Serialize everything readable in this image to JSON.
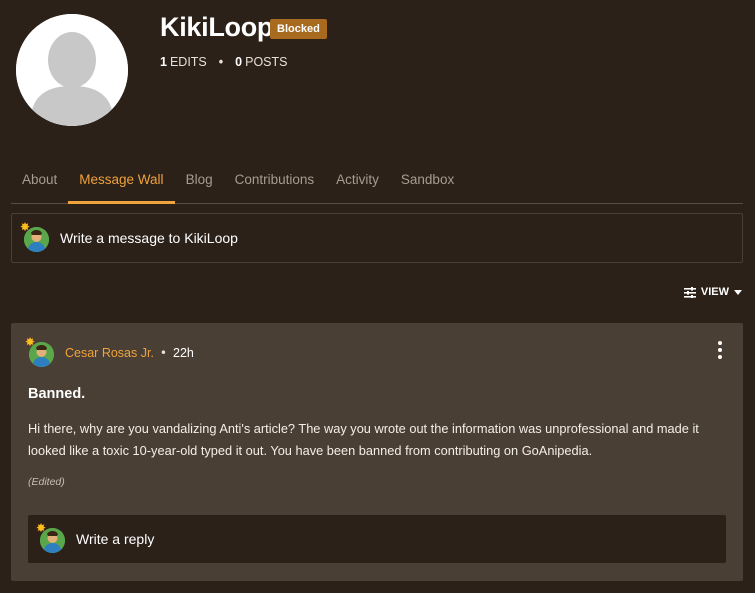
{
  "profile": {
    "username": "KikiLoop",
    "badge": "Blocked",
    "edits_count": "1",
    "edits_label": "EDITS",
    "separator": "•",
    "posts_count": "0",
    "posts_label": "POSTS"
  },
  "tabs": [
    {
      "label": "About"
    },
    {
      "label": "Message Wall",
      "active": true
    },
    {
      "label": "Blog"
    },
    {
      "label": "Contributions"
    },
    {
      "label": "Activity"
    },
    {
      "label": "Sandbox"
    }
  ],
  "composer": {
    "placeholder": "Write a message to KikiLoop"
  },
  "view_toggle": {
    "label": "VIEW"
  },
  "post": {
    "author": "Cesar Rosas Jr.",
    "separator": "•",
    "time": "22h",
    "title": "Banned.",
    "body": "Hi there, why are you vandalizing Anti's article? The way you wrote out the information was unprofessional and made it looked like a toxic 10-year-old typed it out. You have been banned from contributing on GoAnipedia.",
    "edited_label": "(Edited)",
    "reply_placeholder": "Write a reply"
  },
  "colors": {
    "accent": "#f0a23c",
    "background": "#2b2119",
    "card": "#4a3f35",
    "badge": "#a76a1e"
  }
}
